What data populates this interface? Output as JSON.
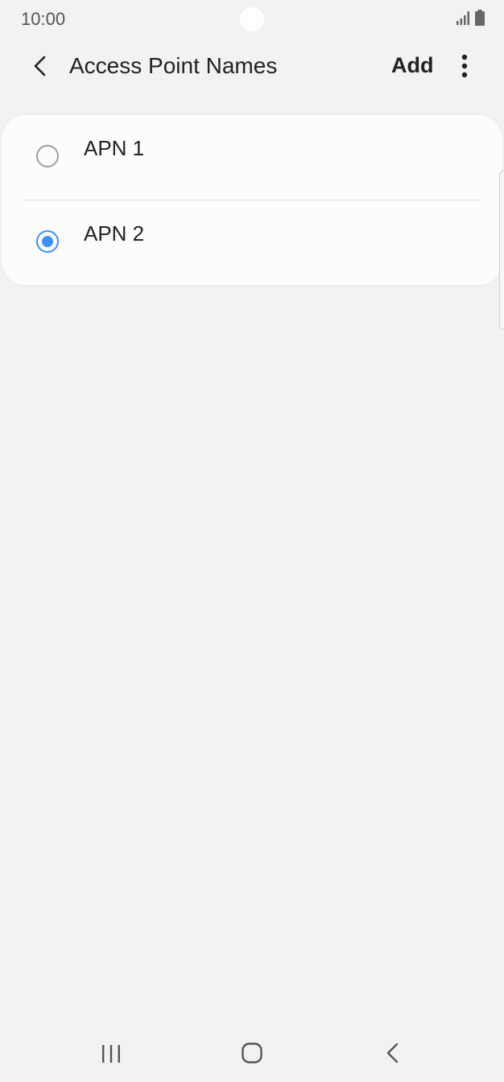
{
  "status_bar": {
    "time": "10:00",
    "icons": [
      "signal-icon",
      "battery-icon"
    ]
  },
  "app_bar": {
    "back_icon": "chevron-left-icon",
    "title": "Access Point Names",
    "add_label": "Add",
    "more_icon": "more-vertical-icon"
  },
  "apn_list": {
    "items": [
      {
        "label": "APN 1",
        "selected": false
      },
      {
        "label": "APN 2",
        "selected": true
      }
    ]
  },
  "nav_bar": {
    "icons": [
      "recents-icon",
      "home-icon",
      "back-icon"
    ]
  },
  "colors": {
    "background": "#f2f2f2",
    "card": "#fcfcfc",
    "accent": "#3e91f7",
    "radio_unselected": "#9e9e9e",
    "text": "#222222"
  }
}
